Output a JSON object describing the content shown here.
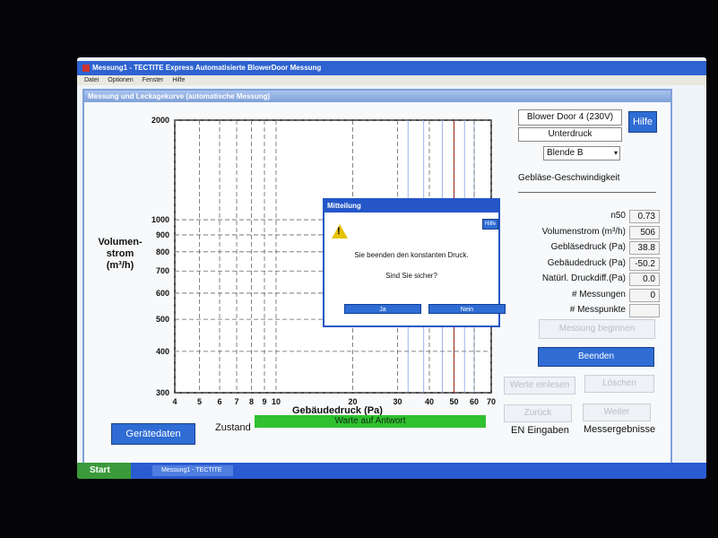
{
  "window": {
    "title": "Messung1 - TECTITE Express Automatisierte BlowerDoor Messung",
    "menu": [
      "Datei",
      "Optionen",
      "Fenster",
      "Hilfe"
    ]
  },
  "panel": {
    "title": "Messung und Leckagekurve (automatische Messung)"
  },
  "chart_data": {
    "type": "line",
    "xlabel": "Gebäudedruck (Pa)",
    "ylabel": "Volumen-strom (m³/h)",
    "xscale": "log",
    "yscale": "log",
    "xlim": [
      4,
      70
    ],
    "ylim": [
      300,
      2000
    ],
    "x_ticks": [
      "4",
      "5",
      "6",
      "7",
      "8",
      "9",
      "10",
      "20",
      "30",
      "40",
      "50",
      "60",
      "70"
    ],
    "y_ticks": [
      "2000",
      "1000",
      "900",
      "800",
      "700",
      "600",
      "500",
      "400",
      "300"
    ],
    "series": []
  },
  "right": {
    "device": "Blower Door 4 (230V)",
    "help": "Hilfe",
    "mode": "Unterdruck",
    "blende": "Blende B",
    "speed_label": "Gebläse-Geschwindigkeit",
    "readings": [
      {
        "label": "n50",
        "value": "0.73"
      },
      {
        "label": "Volumenstrom (m³/h)",
        "value": "506"
      },
      {
        "label": "Gebläsedruck (Pa)",
        "value": "38.8"
      },
      {
        "label": "Gebäudedruck (Pa)",
        "value": "-50.2"
      },
      {
        "label": "Natürl. Druckdiff.(Pa)",
        "value": "0.0"
      },
      {
        "label": "# Messungen",
        "value": "0"
      },
      {
        "label": "# Messpunkte",
        "value": ""
      }
    ],
    "btn_start": "Messung beginnen",
    "btn_end": "Beenden",
    "btn_read": "Werte einlesen",
    "btn_delete": "Löschen",
    "btn_back": "Zurück",
    "btn_next": "Weiter",
    "en_label": "EN Eingaben",
    "results_label": "Messergebnisse"
  },
  "bottom": {
    "device_btn": "Gerätedaten",
    "state_label": "Zustand",
    "status": "Warte auf Antwort"
  },
  "dialog": {
    "title": "Mitteilung",
    "help": "Hilfe",
    "line1": "Sie beenden den konstanten Druck.",
    "line2": "Sind Sie sicher?",
    "yes": "Ja",
    "no": "Nein"
  },
  "taskbar": {
    "start": "Start",
    "task": "Messung1 - TECTITE"
  },
  "colors": {
    "accent": "#2f6cd4",
    "status": "#30c030",
    "marker": "#d03020"
  }
}
